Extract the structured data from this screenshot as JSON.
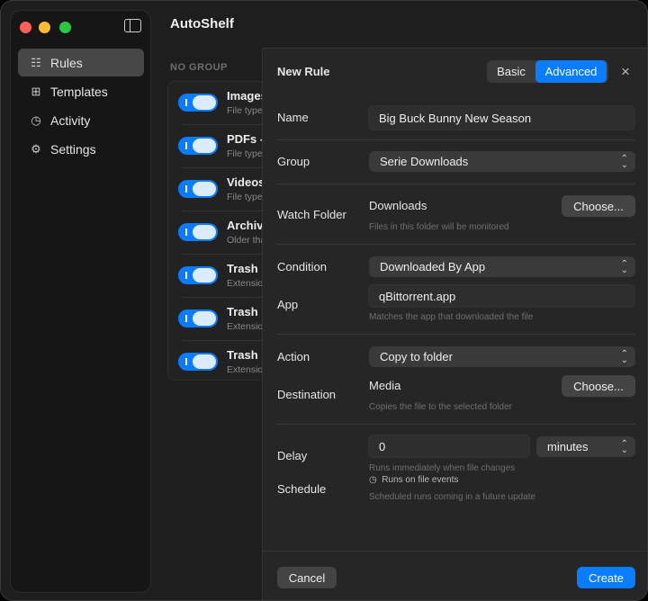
{
  "sidebar": {
    "items": [
      {
        "label": "Rules",
        "icon": "checklist-icon"
      },
      {
        "label": "Templates",
        "icon": "grid-icon"
      },
      {
        "label": "Activity",
        "icon": "clock-icon"
      },
      {
        "label": "Settings",
        "icon": "gear-icon"
      }
    ]
  },
  "app_title": "AutoShelf",
  "group_header": "NO GROUP",
  "rules": [
    {
      "title": "Images",
      "sub": "File type"
    },
    {
      "title": "PDFs -",
      "sub": "File type"
    },
    {
      "title": "Videos",
      "sub": "File type"
    },
    {
      "title": "Archiv",
      "sub": "Older tha"
    },
    {
      "title": "Trash i",
      "sub": "Extensio"
    },
    {
      "title": "Trash .",
      "sub": "Extensio"
    },
    {
      "title": "Trash .",
      "sub": "Extensio"
    }
  ],
  "sheet": {
    "title": "New Rule",
    "modes": [
      "Basic",
      "Advanced"
    ],
    "close": "×",
    "name_label": "Name",
    "name_value": "Big Buck Bunny New Season",
    "group_label": "Group",
    "group_value": "Serie Downloads",
    "watch_label": "Watch Folder",
    "watch_value": "Downloads",
    "choose": "Choose...",
    "watch_caption": "Files in this folder will be monitored",
    "condition_label": "Condition",
    "condition_value": "Downloaded By App",
    "app_label": "App",
    "app_value": "qBittorrent.app",
    "app_caption": "Matches the app that downloaded the file",
    "action_label": "Action",
    "action_value": "Copy to folder",
    "dest_label": "Destination",
    "dest_value": "Media",
    "dest_caption": "Copies the file to the selected folder",
    "delay_label": "Delay",
    "delay_value": "0",
    "delay_unit": "minutes",
    "delay_caption": "Runs immediately when file changes",
    "schedule_label": "Schedule",
    "schedule_value": "Runs on file events",
    "schedule_caption": "Scheduled runs coming in a future update",
    "cancel": "Cancel",
    "create": "Create"
  },
  "colors": {
    "accent": "#0a7cff"
  }
}
